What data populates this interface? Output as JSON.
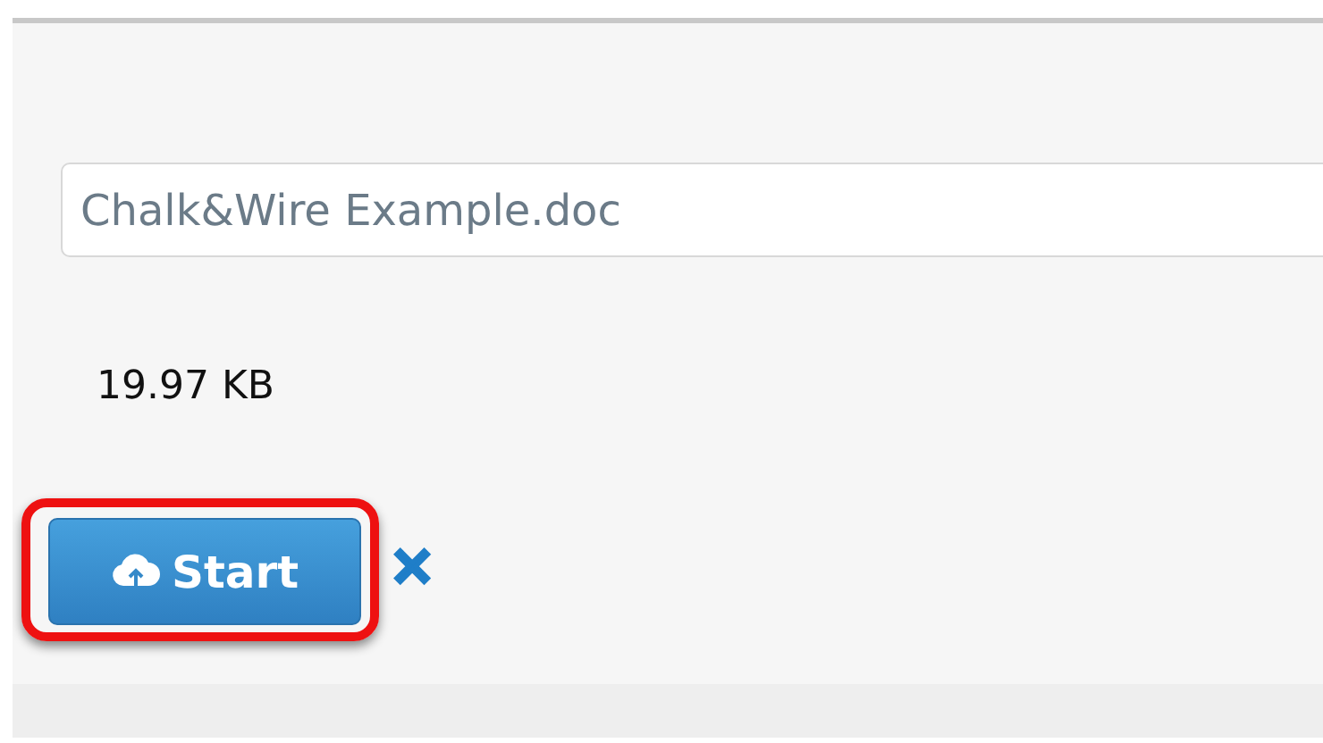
{
  "upload": {
    "file_name": "Chalk&Wire Example.doc",
    "file_size": "19.97 KB",
    "start_button": {
      "label": "Start",
      "highlighted": true
    },
    "cancel": {
      "glyph": "✕"
    }
  }
}
